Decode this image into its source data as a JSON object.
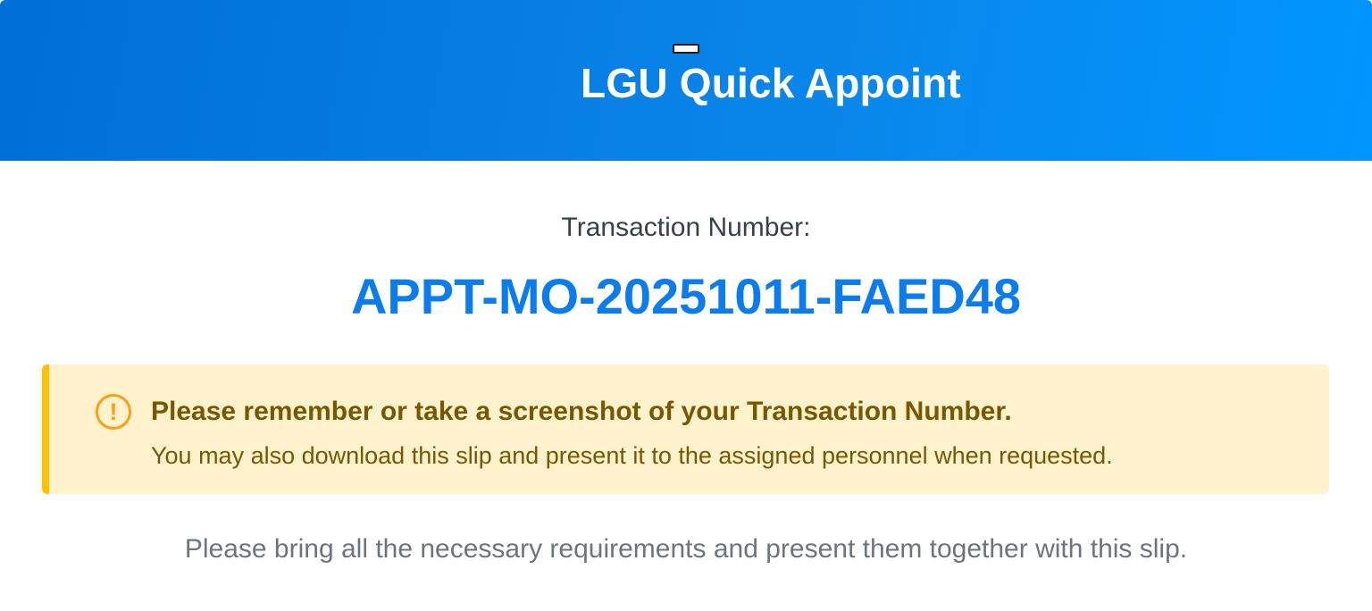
{
  "header": {
    "title": "LGU Quick Appoint",
    "logo_icon": "logo-icon",
    "gradient": [
      "#006fd6",
      "#0096ff"
    ]
  },
  "transaction": {
    "label": "Transaction Number:",
    "number": "APPT-MO-20251011-FAED48",
    "number_color": "#0a7cf0"
  },
  "alert": {
    "icon": "exclamation-circle-icon",
    "icon_glyph": "!",
    "title": "Please remember or take a screenshot of your Transaction Number.",
    "body": "You may also download this slip and present it to the assigned personnel when requested.",
    "background": "#fff2cc",
    "accent": "#ffc000"
  },
  "footer": {
    "note": "Please bring all the necessary requirements and present them together with this slip."
  }
}
